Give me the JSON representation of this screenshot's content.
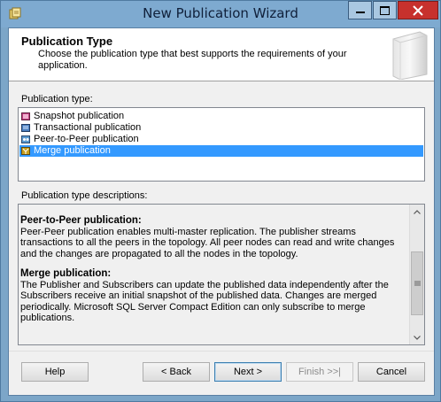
{
  "window": {
    "title": "New Publication Wizard"
  },
  "header": {
    "title": "Publication Type",
    "subtitle": "Choose the publication type that best supports the requirements of your application."
  },
  "publication_type": {
    "label": "Publication type:",
    "items": [
      {
        "label": "Snapshot publication",
        "icon": "snapshot-publication-icon",
        "selected": false
      },
      {
        "label": "Transactional publication",
        "icon": "transactional-publication-icon",
        "selected": false
      },
      {
        "label": "Peer-to-Peer publication",
        "icon": "peer-to-peer-publication-icon",
        "selected": false
      },
      {
        "label": "Merge publication",
        "icon": "merge-publication-icon",
        "selected": true
      }
    ]
  },
  "descriptions": {
    "label": "Publication type descriptions:",
    "sections": [
      {
        "heading": "Peer-to-Peer publication:",
        "body": "Peer-Peer publication enables multi-master replication. The publisher streams transactions to all the peers in the topology. All peer nodes can read and write changes and the changes are propagated to all the nodes in the topology."
      },
      {
        "heading": "Merge publication:",
        "body": "The Publisher and Subscribers can update the published data independently after the Subscribers receive an initial snapshot of the published data. Changes are merged periodically. Microsoft SQL Server Compact Edition can only subscribe to merge publications."
      }
    ]
  },
  "buttons": {
    "help": "Help",
    "back": "< Back",
    "next": "Next >",
    "finish": "Finish >>|",
    "cancel": "Cancel"
  },
  "colors": {
    "selection": "#3399ff",
    "title_bar": "#7eaad0",
    "close_button": "#c7312d"
  }
}
